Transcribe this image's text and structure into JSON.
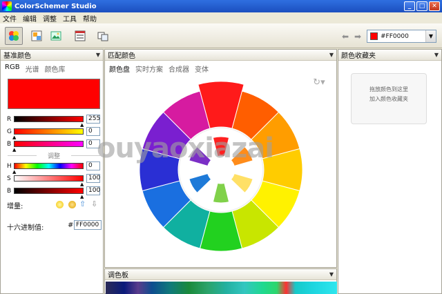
{
  "window": {
    "title": "ColorSchemer Studio",
    "buttons": [
      "_",
      "□",
      "✕"
    ]
  },
  "menubar": {
    "items": [
      "文件",
      "编辑",
      "调整",
      "工具",
      "帮助"
    ]
  },
  "toolbar": {
    "buttons": [
      "color-wheel-icon",
      "picker-icon",
      "image-icon",
      "gallery-icon",
      "export-icon"
    ],
    "back_icon": "left-arrow-icon",
    "forward_icon": "right-arrow-icon",
    "current_color_hex": "#FF0000",
    "current_color_label": "#FF0000"
  },
  "left_pane": {
    "title": "基准颜色",
    "tabs": [
      "RGB",
      "光谱",
      "颜色库"
    ],
    "active_tab": "RGB",
    "swatch_color": "#FF0000",
    "rgb": {
      "r_label": "R",
      "r_value": "255",
      "g_label": "G",
      "g_value": "0",
      "b_label": "B",
      "b_value": "0"
    },
    "adjust_label": "调整",
    "hsb": {
      "h_label": "H",
      "h_value": "0",
      "s_label": "S",
      "s_value": "100",
      "b_label": "B",
      "b_value": "100"
    },
    "increment_label": "增量:",
    "hex_label": "十六进制值:",
    "hex_hash": "#",
    "hex_value": "FF0000"
  },
  "center_pane": {
    "title": "匹配颜色",
    "tabs": [
      "颜色盘",
      "实时方案",
      "合成器",
      "变体"
    ],
    "active_tab": "颜色盘"
  },
  "right_pane": {
    "title": "颜色收藏夹",
    "hint_line1": "拖放颜色到这里",
    "hint_line2": "加入颜色收藏夹"
  },
  "palette_pane": {
    "title": "调色板"
  },
  "watermark": "ouyaoxiazai",
  "colors": {
    "accent": "#FF0000",
    "titlebar": "#1B4FBF"
  }
}
